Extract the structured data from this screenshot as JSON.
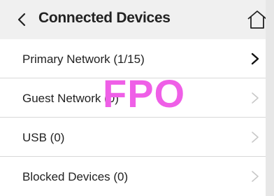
{
  "header": {
    "title": "Connected Devices",
    "back_icon": "chevron-left-icon",
    "home_icon": "home-icon"
  },
  "rows": [
    {
      "label": "Primary Network (1/15)",
      "chevron_color": "#111111"
    },
    {
      "label": "Guest Network (0)",
      "chevron_color": "#c8c8c8"
    },
    {
      "label": "USB (0)",
      "chevron_color": "#c8c8c8"
    },
    {
      "label": "Blocked Devices (0)",
      "chevron_color": "#c8c8c8"
    }
  ],
  "overlay": {
    "text": "FPO",
    "color": "#ef5fe7"
  },
  "colors": {
    "header_bg": "#f0f0f0",
    "divider": "#d8d8d8"
  }
}
